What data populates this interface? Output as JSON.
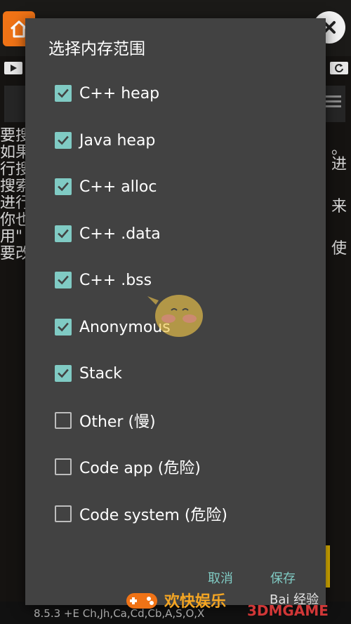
{
  "dialog": {
    "title": "选择内存范围",
    "options": [
      {
        "label": "C++ heap",
        "checked": true
      },
      {
        "label": "Java heap",
        "checked": true
      },
      {
        "label": "C++ alloc",
        "checked": true
      },
      {
        "label": "C++ .data",
        "checked": true
      },
      {
        "label": "C++ .bss",
        "checked": true
      },
      {
        "label": "Anonymous",
        "checked": true
      },
      {
        "label": "Stack",
        "checked": true
      },
      {
        "label": "Other (慢)",
        "checked": false
      },
      {
        "label": "Code app (危险)",
        "checked": false
      },
      {
        "label": "Code system (危险)",
        "checked": false
      }
    ],
    "cancel_label": "取消",
    "save_label": "保存"
  },
  "background": {
    "text_lines": [
      "要搜",
      "如果",
      "行搜",
      "搜索",
      "进行",
      "你也",
      "用\"",
      "要改"
    ],
    "right_fragments": [
      "。",
      "进",
      "来",
      "使"
    ],
    "footer_text": "8.5.3  +E Ch,Jh,Ca,Cd,Cb,A,S,O,X"
  },
  "watermarks": {
    "brand": "欢快娱乐",
    "baidu": "Bai  经验",
    "game": "3DMGAME"
  },
  "colors": {
    "accent": "#80cbc4",
    "dialog_bg": "#424242",
    "home_button": "#f07316"
  },
  "icons": {
    "home": "home-icon",
    "close": "close-icon",
    "check": "check-icon",
    "menu": "menu-icon",
    "play": "play-icon"
  }
}
